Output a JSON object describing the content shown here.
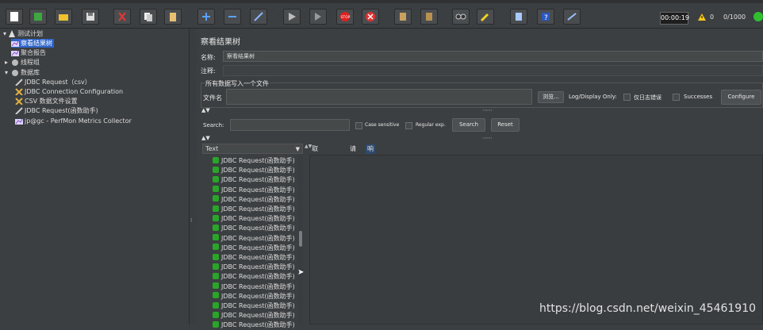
{
  "toolbar": {
    "buttons": [
      "new",
      "templates",
      "open",
      "save",
      "cut",
      "copy",
      "paste",
      "expand",
      "collapse",
      "toggle",
      "start",
      "start-no-pause",
      "stop",
      "shutdown",
      "clear",
      "clear-all",
      "search",
      "reset-search",
      "function-helper",
      "help",
      "remote"
    ],
    "timer": "00:00:19",
    "warnings": "0",
    "threads": "0/1000",
    "stop_label": "STOP"
  },
  "tree": {
    "items": [
      {
        "label": "测试计划",
        "level": 0,
        "icon": "test-plan-icon"
      },
      {
        "label": "察看结果树",
        "level": 1,
        "icon": "listener-icon",
        "selected": true
      },
      {
        "label": "聚合报告",
        "level": 1,
        "icon": "listener-icon"
      },
      {
        "label": "线程组",
        "level": 1,
        "icon": "thread-group-icon"
      },
      {
        "label": "数据库",
        "level": 1,
        "icon": "thread-group-icon"
      },
      {
        "label": "JDBC Request（csv）",
        "level": 2,
        "icon": "sampler-icon"
      },
      {
        "label": "JDBC Connection Configuration",
        "level": 2,
        "icon": "config-icon"
      },
      {
        "label": "CSV 数据文件设置",
        "level": 2,
        "icon": "config-icon"
      },
      {
        "label": "JDBC Request(函数助手)",
        "level": 2,
        "icon": "sampler-icon"
      },
      {
        "label": "jp@gc - PerfMon Metrics Collector",
        "level": 2,
        "icon": "listener-icon"
      }
    ]
  },
  "panel": {
    "title": "察看结果树",
    "name_label": "名称:",
    "name_value": "察看结果树",
    "comment_label": "注释:",
    "comment_value": "",
    "file_section_label": "所有数据写入一个文件",
    "filename_label": "文件名",
    "filename_value": "",
    "browse_label": "浏览...",
    "logdisplay_label": "Log/Display Only:",
    "errors_only_label": "仅日志错误",
    "successes_label": "Successes",
    "configure_label": "Configure"
  },
  "search": {
    "label": "Search:",
    "value": "",
    "case_sensitive_label": "Case sensitive",
    "regex_label": "Regular exp.",
    "search_button": "Search",
    "reset_button": "Reset"
  },
  "results": {
    "renderer": "Text",
    "rows": [
      "JDBC Request(函数助手)",
      "JDBC Request(函数助手)",
      "JDBC Request(函数助手)",
      "JDBC Request(函数助手)",
      "JDBC Request(函数助手)",
      "JDBC Request(函数助手)",
      "JDBC Request(函数助手)",
      "JDBC Request(函数助手)",
      "JDBC Request(函数助手)",
      "JDBC Request(函数助手)",
      "JDBC Request(函数助手)",
      "JDBC Request(函数助手)",
      "JDBC Request(函数助手)",
      "JDBC Request(函数助手)",
      "JDBC Request(函数助手)",
      "JDBC Request(函数助手)",
      "JDBC Request(函数助手)",
      "JDBC Request(函数助手)"
    ]
  },
  "detail": {
    "tabs": [
      {
        "label": "取样器结果",
        "active": false
      },
      {
        "label": "请求",
        "active": false
      },
      {
        "label": "响应数据",
        "active": true
      }
    ]
  },
  "watermark": "https://blog.csdn.net/weixin_45461910"
}
